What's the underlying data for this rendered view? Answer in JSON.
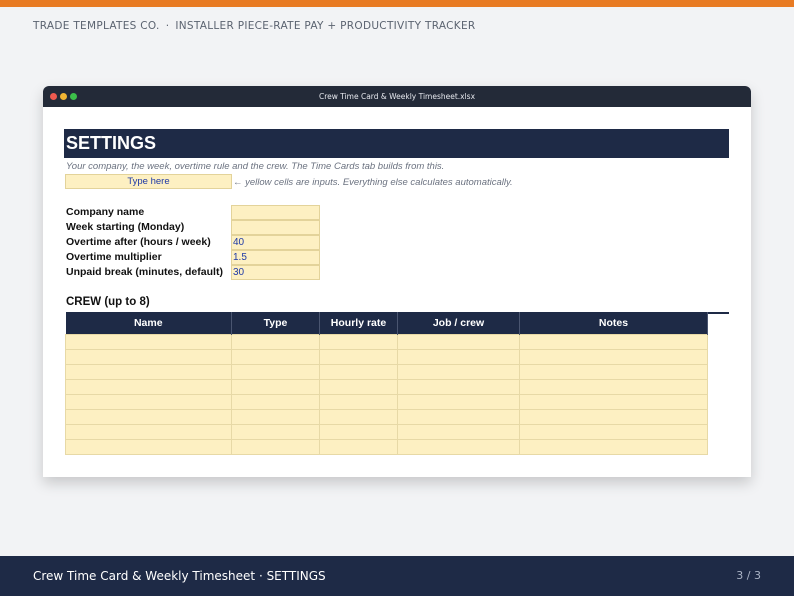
{
  "header": {
    "company": "TRADE TEMPLATES CO.",
    "separator": "·",
    "product": "INSTALLER PIECE-RATE PAY + PRODUCTIVITY TRACKER"
  },
  "window": {
    "title": "Crew Time Card & Weekly Timesheet.xlsx"
  },
  "sheet": {
    "title": "SETTINGS",
    "subtitle": "Your company, the week, overtime rule and the crew. The Time Cards tab builds from this.",
    "input_sample": "Type here",
    "input_hint": "← yellow cells are inputs. Everything else calculates automatically.",
    "fields": [
      {
        "label": "Company name",
        "value": ""
      },
      {
        "label": "Week starting (Monday)",
        "value": ""
      },
      {
        "label": "Overtime after (hours / week)",
        "value": "40"
      },
      {
        "label": "Overtime multiplier",
        "value": "1.5"
      },
      {
        "label": "Unpaid break (minutes, default)",
        "value": "30"
      }
    ],
    "crew_title": "CREW (up to 8)",
    "crew_columns": [
      "Name",
      "Type",
      "Hourly rate",
      "Job / crew",
      "Notes"
    ],
    "crew_rows": 8
  },
  "footer": {
    "title": "Crew Time Card & Weekly Timesheet · SETTINGS",
    "page": "3 / 3"
  },
  "colors": {
    "accent": "#e87b23",
    "navy": "#1e2a46",
    "input_fill": "#fdf0c2",
    "input_text": "#1f3aa6"
  }
}
